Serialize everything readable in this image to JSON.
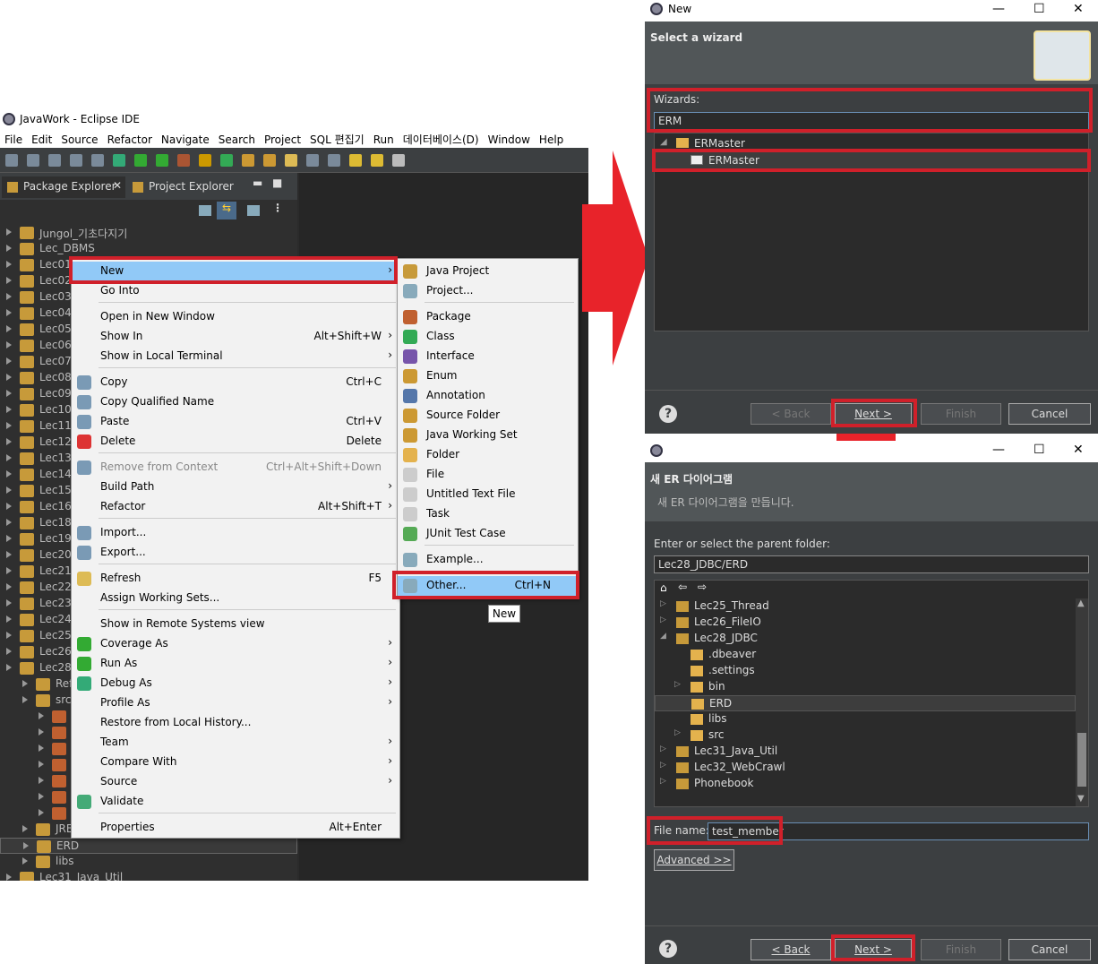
{
  "eclipse": {
    "title": "JavaWork - Eclipse IDE",
    "menu": [
      "File",
      "Edit",
      "Source",
      "Refactor",
      "Navigate",
      "Search",
      "Project",
      "SQL 편집기",
      "Run",
      "데이터베이스(D)",
      "Window",
      "Help"
    ],
    "tabs": {
      "package_explorer": "Package Explorer",
      "project_explorer": "Project Explorer"
    },
    "tree": [
      {
        "label": "Jungol_기초다지기"
      },
      {
        "label": "Lec_DBMS"
      },
      {
        "label": "Lec01_"
      },
      {
        "label": "Lec02"
      },
      {
        "label": "Lec03"
      },
      {
        "label": "Lec04"
      },
      {
        "label": "Lec05"
      },
      {
        "label": "Lec06"
      },
      {
        "label": "Lec07"
      },
      {
        "label": "Lec08"
      },
      {
        "label": "Lec09"
      },
      {
        "label": "Lec10"
      },
      {
        "label": "Lec11"
      },
      {
        "label": "Lec12"
      },
      {
        "label": "Lec13"
      },
      {
        "label": "Lec14"
      },
      {
        "label": "Lec15"
      },
      {
        "label": "Lec16"
      },
      {
        "label": "Lec18"
      },
      {
        "label": "Lec19"
      },
      {
        "label": "Lec20"
      },
      {
        "label": "Lec21"
      },
      {
        "label": "Lec22"
      },
      {
        "label": "Lec23"
      },
      {
        "label": "Lec24"
      },
      {
        "label": "Lec25"
      },
      {
        "label": "Lec26"
      },
      {
        "label": "Lec28"
      },
      {
        "label": "Ref"
      },
      {
        "label": "src"
      },
      {
        "label": ""
      },
      {
        "label": ""
      },
      {
        "label": ""
      },
      {
        "label": ""
      },
      {
        "label": ""
      },
      {
        "label": ""
      },
      {
        "label": ""
      },
      {
        "label": "JRE"
      },
      {
        "label": "ERD"
      },
      {
        "label": "libs"
      },
      {
        "label": "Lec31_Java_Util"
      }
    ]
  },
  "context_menu": {
    "items": [
      {
        "label": "New",
        "acc": "",
        "arrow": "›"
      },
      {
        "label": "Go Into",
        "acc": "",
        "arrow": ""
      },
      {
        "label": "Open in New Window",
        "acc": "",
        "arrow": ""
      },
      {
        "label": "Show In",
        "acc": "Alt+Shift+W",
        "arrow": "›"
      },
      {
        "label": "Show in Local Terminal",
        "acc": "",
        "arrow": "›"
      },
      {
        "label": "Copy",
        "acc": "Ctrl+C",
        "arrow": ""
      },
      {
        "label": "Copy Qualified Name",
        "acc": "",
        "arrow": ""
      },
      {
        "label": "Paste",
        "acc": "Ctrl+V",
        "arrow": ""
      },
      {
        "label": "Delete",
        "acc": "Delete",
        "arrow": ""
      },
      {
        "label": "Remove from Context",
        "acc": "Ctrl+Alt+Shift+Down",
        "arrow": ""
      },
      {
        "label": "Build Path",
        "acc": "",
        "arrow": "›"
      },
      {
        "label": "Refactor",
        "acc": "Alt+Shift+T",
        "arrow": "›"
      },
      {
        "label": "Import...",
        "acc": "",
        "arrow": ""
      },
      {
        "label": "Export...",
        "acc": "",
        "arrow": ""
      },
      {
        "label": "Refresh",
        "acc": "F5",
        "arrow": ""
      },
      {
        "label": "Assign Working Sets...",
        "acc": "",
        "arrow": ""
      },
      {
        "label": "Show in Remote Systems view",
        "acc": "",
        "arrow": ""
      },
      {
        "label": "Coverage As",
        "acc": "",
        "arrow": "›"
      },
      {
        "label": "Run As",
        "acc": "",
        "arrow": "›"
      },
      {
        "label": "Debug As",
        "acc": "",
        "arrow": "›"
      },
      {
        "label": "Profile As",
        "acc": "",
        "arrow": "›"
      },
      {
        "label": "Restore from Local History...",
        "acc": "",
        "arrow": ""
      },
      {
        "label": "Team",
        "acc": "",
        "arrow": "›"
      },
      {
        "label": "Compare With",
        "acc": "",
        "arrow": "›"
      },
      {
        "label": "Source",
        "acc": "",
        "arrow": "›"
      },
      {
        "label": "Validate",
        "acc": "",
        "arrow": ""
      },
      {
        "label": "Properties",
        "acc": "Alt+Enter",
        "arrow": ""
      }
    ]
  },
  "submenu": {
    "items": [
      {
        "label": "Java Project",
        "acc": ""
      },
      {
        "label": "Project...",
        "acc": ""
      },
      {
        "label": "Package",
        "acc": ""
      },
      {
        "label": "Class",
        "acc": ""
      },
      {
        "label": "Interface",
        "acc": ""
      },
      {
        "label": "Enum",
        "acc": ""
      },
      {
        "label": "Annotation",
        "acc": ""
      },
      {
        "label": "Source Folder",
        "acc": ""
      },
      {
        "label": "Java Working Set",
        "acc": ""
      },
      {
        "label": "Folder",
        "acc": ""
      },
      {
        "label": "File",
        "acc": ""
      },
      {
        "label": "Untitled Text File",
        "acc": ""
      },
      {
        "label": "Task",
        "acc": ""
      },
      {
        "label": "JUnit Test Case",
        "acc": ""
      },
      {
        "label": "Example...",
        "acc": ""
      },
      {
        "label": "Other...",
        "acc": "Ctrl+N"
      }
    ],
    "tooltip": "New"
  },
  "wizard_dialog": {
    "title": "New",
    "heading": "Select a wizard",
    "wizards_label": "Wizards:",
    "filter_value": "ERM",
    "tree": [
      {
        "label": "ERMaster"
      },
      {
        "label": "ERMaster"
      }
    ],
    "buttons": {
      "back": "< Back",
      "next": "Next >",
      "finish": "Finish",
      "cancel": "Cancel"
    }
  },
  "er_dialog": {
    "heading": "새 ER 다이어그램",
    "subheading": "새 ER 다이어그램을 만듭니다.",
    "parent_label": "Enter or select the parent folder:",
    "parent_value": "Lec28_JDBC/ERD",
    "tree": [
      {
        "label": "Lec25_Thread"
      },
      {
        "label": "Lec26_FileIO"
      },
      {
        "label": "Lec28_JDBC"
      },
      {
        "label": ".dbeaver"
      },
      {
        "label": ".settings"
      },
      {
        "label": "bin"
      },
      {
        "label": "ERD"
      },
      {
        "label": "libs"
      },
      {
        "label": "src"
      },
      {
        "label": "Lec31_Java_Util"
      },
      {
        "label": "Lec32_WebCrawl"
      },
      {
        "label": "Phonebook"
      }
    ],
    "file_label": "File name:",
    "file_value": "test_member",
    "advanced": "Advanced >>",
    "buttons": {
      "back": "< Back",
      "next": "Next >",
      "finish": "Finish",
      "cancel": "Cancel"
    }
  },
  "colors": {
    "highlight": "#d0202a",
    "arrow": "#e8232a",
    "menu_hl": "#91c9f7"
  }
}
